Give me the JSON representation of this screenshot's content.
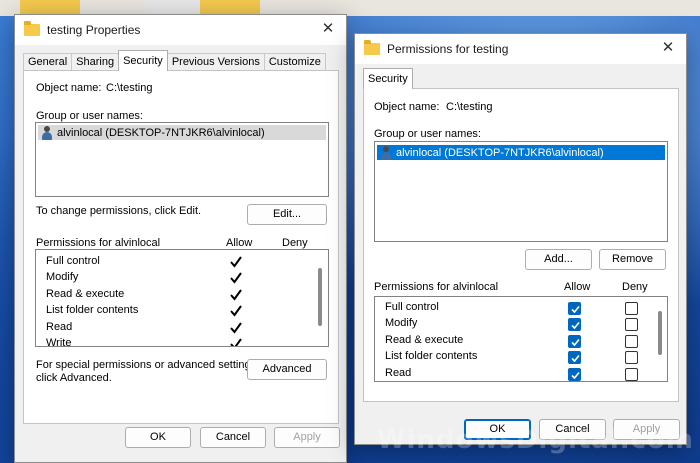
{
  "watermark": "WindowsDigital.com",
  "props_window": {
    "title": "testing Properties",
    "tabs": [
      "General",
      "Sharing",
      "Security",
      "Previous Versions",
      "Customize"
    ],
    "active_tab": "Security",
    "object_name_label": "Object name:",
    "object_name_value": "C:\\testing",
    "group_label": "Group or user names:",
    "users": [
      "alvinlocal (DESKTOP-7NTJKR6\\alvinlocal)"
    ],
    "change_hint": "To change permissions, click Edit.",
    "edit_button": "Edit...",
    "permissions_label": "Permissions for alvinlocal",
    "allow_header": "Allow",
    "deny_header": "Deny",
    "permissions": [
      {
        "name": "Full control",
        "allow": true,
        "deny": false
      },
      {
        "name": "Modify",
        "allow": true,
        "deny": false
      },
      {
        "name": "Read & execute",
        "allow": true,
        "deny": false
      },
      {
        "name": "List folder contents",
        "allow": true,
        "deny": false
      },
      {
        "name": "Read",
        "allow": true,
        "deny": false
      },
      {
        "name": "Write",
        "allow": true,
        "deny": false
      }
    ],
    "special_hint_line1": "For special permissions or advanced settings,",
    "special_hint_line2": "click Advanced.",
    "advanced_button": "Advanced",
    "ok": "OK",
    "cancel": "Cancel",
    "apply": "Apply"
  },
  "perm_window": {
    "title": "Permissions for testing",
    "tab": "Security",
    "object_name_label": "Object name:",
    "object_name_value": "C:\\testing",
    "group_label": "Group or user names:",
    "users": [
      "alvinlocal (DESKTOP-7NTJKR6\\alvinlocal)"
    ],
    "add_button": "Add...",
    "remove_button": "Remove",
    "permissions_label": "Permissions for alvinlocal",
    "allow_header": "Allow",
    "deny_header": "Deny",
    "permissions": [
      {
        "name": "Full control",
        "allow": true,
        "deny": false
      },
      {
        "name": "Modify",
        "allow": true,
        "deny": false
      },
      {
        "name": "Read & execute",
        "allow": true,
        "deny": false
      },
      {
        "name": "List folder contents",
        "allow": true,
        "deny": false
      },
      {
        "name": "Read",
        "allow": true,
        "deny": false
      }
    ],
    "ok": "OK",
    "cancel": "Cancel",
    "apply": "Apply"
  }
}
